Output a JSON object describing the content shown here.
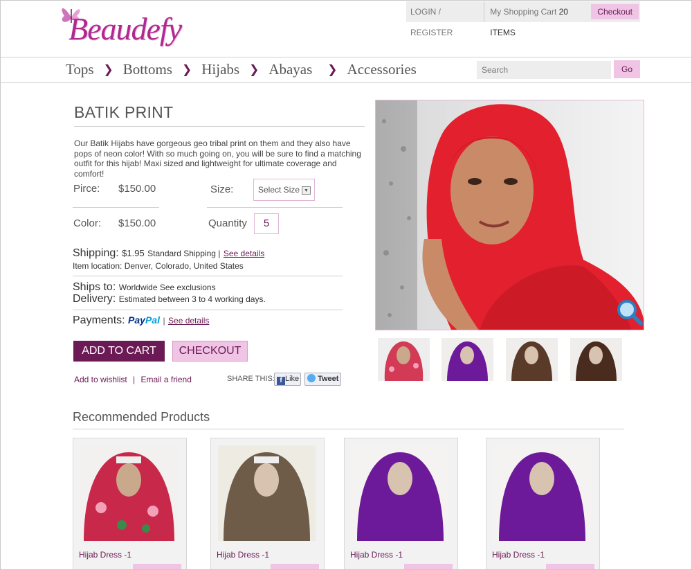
{
  "logo_text": "Beaudefy",
  "topbar": {
    "login": "LOGIN / REGISTER",
    "cart_label": "My Shopping Cart",
    "cart_count": "20 ITEMS",
    "checkout": "Checkout"
  },
  "nav": [
    "Tops",
    "Bottoms",
    "Hijabs",
    "Abayas",
    "Accessories"
  ],
  "nav_sep": "❯",
  "search": {
    "placeholder": "Search",
    "go": "Go"
  },
  "product": {
    "title": "BATIK PRINT",
    "description": "Our Batik Hijabs have gorgeous geo tribal print on them and they also have pops of neon color! With so much going on, you will be sure to find a matching outfit for this hijab! Maxi sized and lightweight for ultimate coverage and comfort!",
    "price_label": "Pirce:",
    "price": "$150.00",
    "size_label": "Size:",
    "size_select": "Select Size",
    "color_label": "Color:",
    "color_value": "$150.00",
    "quantity_label": "Quantity",
    "quantity": "5",
    "shipping_label": "Shipping:",
    "shipping_price": "$1.95",
    "shipping_method": "Standard Shipping |",
    "see_details": "See details",
    "item_location": "Item location: Denver, Colorado, United States",
    "ships_to_label": "Ships to:",
    "ships_to": "Worldwide See exclusions",
    "delivery_label": "Delivery:",
    "delivery": "Estimated between 3 to 4 working days.",
    "payments_label": "Payments:",
    "paypal_a": "Pay",
    "paypal_b": "Pal",
    "payments_sep": "|",
    "add_to_cart": "ADD TO CART",
    "checkout": "CHECKOUT",
    "wishlist": "Add to wishlist",
    "link_sep": "|",
    "email_friend": "Email a friend",
    "share_this": "SHARE THIS:",
    "like": "Like",
    "tweet": "Tweet"
  },
  "recommended": {
    "title": "Recommended Products",
    "items": [
      {
        "name": "Hijab Dress -1"
      },
      {
        "name": "Hijab Dress -1"
      },
      {
        "name": "Hijab Dress -1"
      },
      {
        "name": "Hijab Dress -1"
      }
    ]
  },
  "colors": {
    "accent_dark": "#6b1a55",
    "accent_light": "#f0c4e4",
    "brand": "#b0298f"
  },
  "icons": [
    "butterfly-icon",
    "magnifier-zoom-icon",
    "dropdown-arrow-icon",
    "facebook-icon",
    "twitter-icon"
  ]
}
